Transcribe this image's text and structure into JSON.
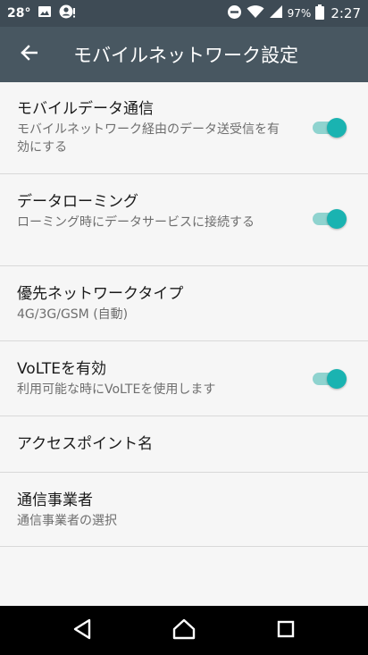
{
  "status_bar": {
    "temperature": "28°",
    "battery_percent": "97%",
    "time": "2:27",
    "icons": [
      "image-icon",
      "account-alert-icon",
      "do-not-disturb-icon",
      "wifi-icon",
      "cellular-signal-icon",
      "battery-icon"
    ]
  },
  "toolbar": {
    "title": "モバイルネットワーク設定",
    "back_icon": "arrow-back-icon"
  },
  "settings": {
    "mobile_data": {
      "title": "モバイルデータ通信",
      "summary": "モバイルネットワーク経由のデータ送受信を有効にする",
      "enabled": true
    },
    "roaming": {
      "title": "データローミング",
      "summary": "ローミング時にデータサービスに接続する",
      "enabled": true
    },
    "network_type": {
      "title": "優先ネットワークタイプ",
      "summary": "4G/3G/GSM (自動)"
    },
    "volte": {
      "title": "VoLTEを有効",
      "summary": "利用可能な時にVoLTEを使用します",
      "enabled": true
    },
    "apn": {
      "title": "アクセスポイント名"
    },
    "operator": {
      "title": "通信事業者",
      "summary": "通信事業者の選択"
    }
  },
  "colors": {
    "status_bar": "#3e4b55",
    "toolbar": "#485761",
    "accent": "#1ab3b1",
    "accent_track": "#8fd3cf"
  },
  "nav_bar": {
    "icons": [
      "back-triangle-icon",
      "home-icon",
      "recents-icon"
    ]
  }
}
